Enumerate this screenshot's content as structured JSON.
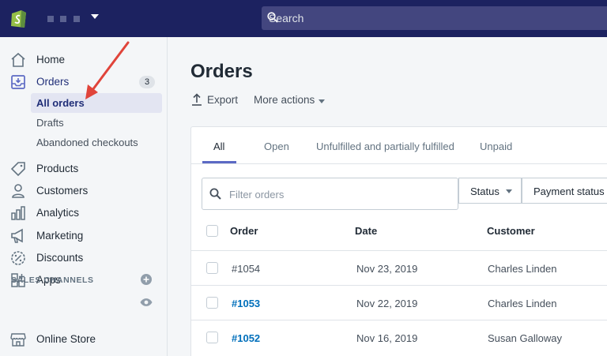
{
  "topbar": {
    "search_placeholder": "Search",
    "colors": {
      "bg": "#1c2260",
      "search_bg": "#43467f"
    }
  },
  "sidebar": {
    "items": [
      {
        "label": "Home",
        "icon": "home-icon"
      },
      {
        "label": "Orders",
        "icon": "orders-icon",
        "badge": "3"
      },
      {
        "label": "Products",
        "icon": "tag-icon"
      },
      {
        "label": "Customers",
        "icon": "person-icon"
      },
      {
        "label": "Analytics",
        "icon": "bar-chart-icon"
      },
      {
        "label": "Marketing",
        "icon": "megaphone-icon"
      },
      {
        "label": "Discounts",
        "icon": "discount-icon"
      },
      {
        "label": "Apps",
        "icon": "apps-icon"
      }
    ],
    "orders_sub": [
      {
        "label": "All orders",
        "selected": true
      },
      {
        "label": "Drafts"
      },
      {
        "label": "Abandoned checkouts"
      }
    ],
    "sales_channels_label": "SALES CHANNELS",
    "online_store_label": "Online Store"
  },
  "main": {
    "title": "Orders",
    "actions": {
      "export": "Export",
      "more": "More actions"
    },
    "tabs": [
      "All",
      "Open",
      "Unfulfilled and partially fulfilled",
      "Unpaid"
    ],
    "filter": {
      "placeholder": "Filter orders",
      "status": "Status",
      "payment_status": "Payment status"
    },
    "table": {
      "headers": [
        "Order",
        "Date",
        "Customer"
      ],
      "rows": [
        {
          "order": "#1054",
          "date": "Nov 23, 2019",
          "customer": "Charles Linden"
        },
        {
          "order": "#1053",
          "date": "Nov 22, 2019",
          "customer": "Charles Linden"
        },
        {
          "order": "#1052",
          "date": "Nov 16, 2019",
          "customer": "Susan Galloway"
        }
      ]
    },
    "colors": {
      "accent": "#5c6ac4",
      "link": "#006fbb",
      "annotation": "#e0443a"
    }
  }
}
